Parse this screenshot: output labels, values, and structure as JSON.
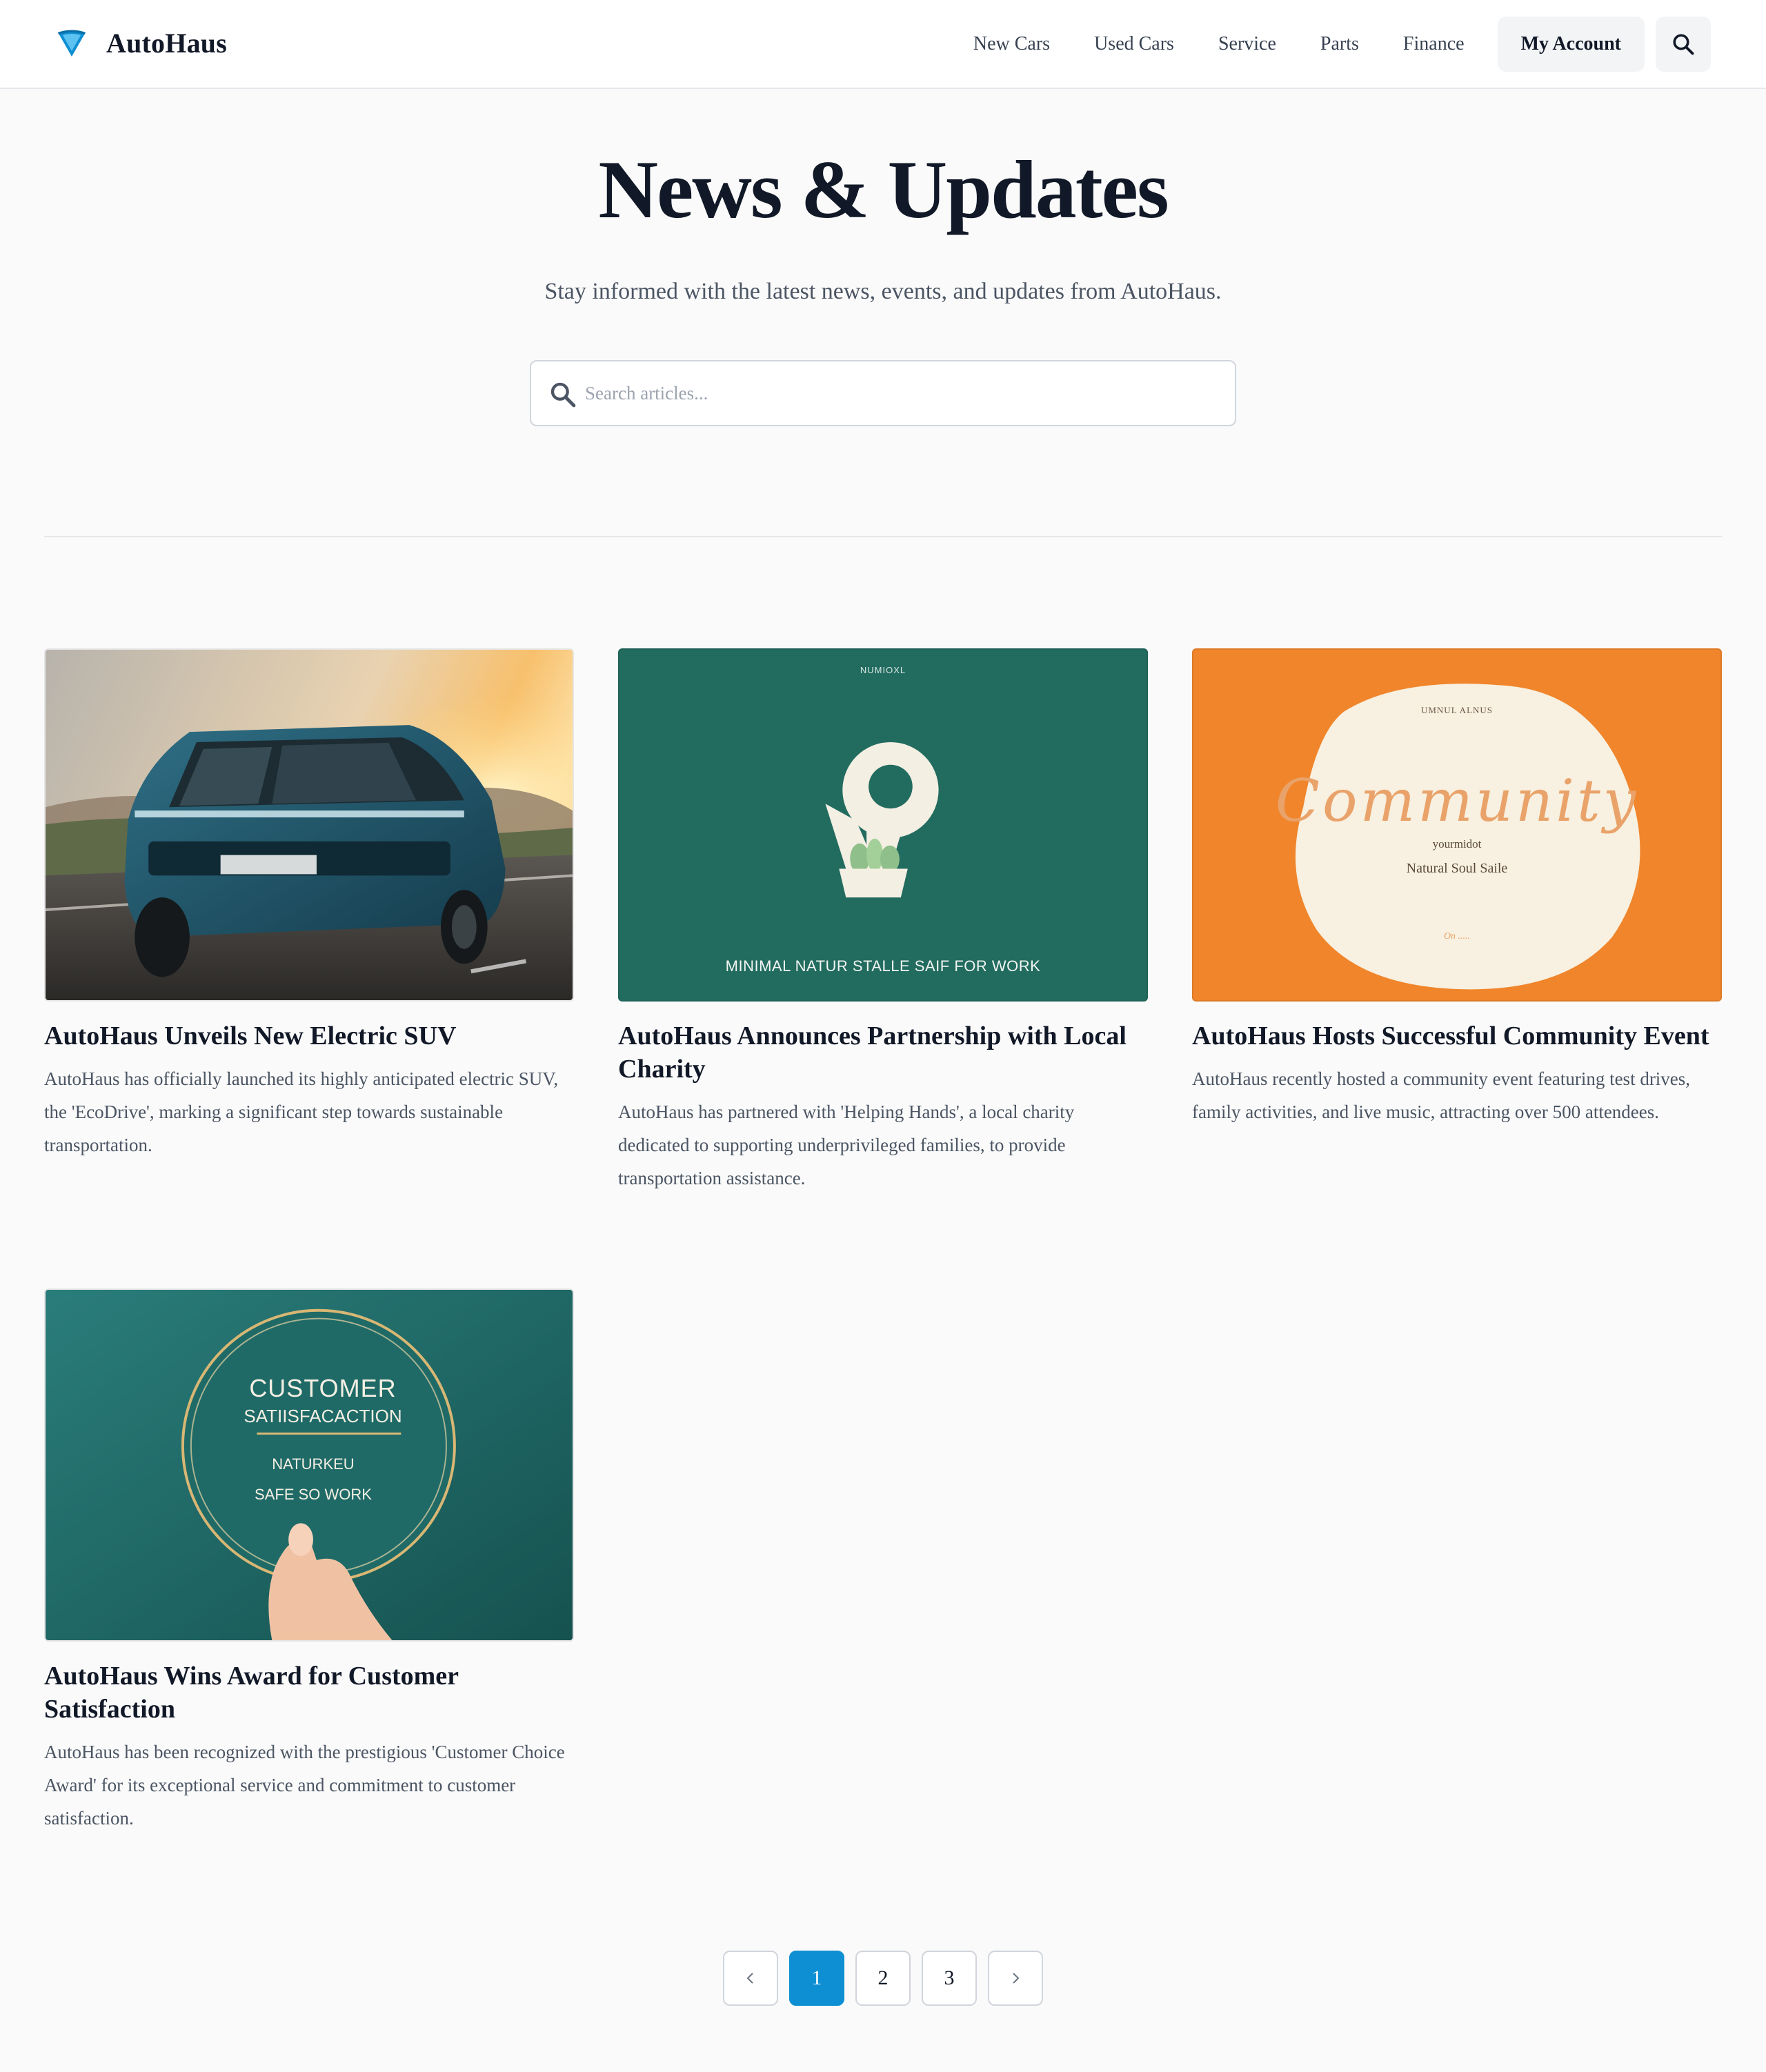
{
  "brand": {
    "name": "AutoHaus",
    "accent_color": "#0e8fd3"
  },
  "nav": {
    "links": [
      "New Cars",
      "Used Cars",
      "Service",
      "Parts",
      "Finance"
    ],
    "account_label": "My Account",
    "search_icon": "search-icon"
  },
  "hero": {
    "title": "News & Updates",
    "subtitle": "Stay informed with the latest news, events, and updates from AutoHaus.",
    "search_placeholder": "Search articles..."
  },
  "articles": [
    {
      "title": "AutoHaus Unveils New Electric SUV",
      "excerpt": "AutoHaus has officially launched its highly anticipated electric SUV, the 'EcoDrive', marking a significant step towards sustainable transportation.",
      "image": "electric-suv-on-road"
    },
    {
      "title": "AutoHaus Announces Partnership with Local Charity",
      "excerpt": "AutoHaus has partnered with 'Helping Hands', a local charity dedicated to supporting underprivileged families, to provide transportation assistance.",
      "image": "charity-plant-illustration",
      "image_text": {
        "top": "NUMIOXL",
        "bottom": "MINIMAL NATUR STALLE SAIF FOR WORK"
      }
    },
    {
      "title": "AutoHaus Hosts Successful Community Event",
      "excerpt": "AutoHaus recently hosted a community event featuring test drives, family activities, and live music, attracting over 500 attendees.",
      "image": "community-event-card",
      "image_text": {
        "top": "UMNUL ALNUS",
        "script": "Community",
        "line1": "yourmidot",
        "line2": "Natural Soul Saile",
        "line3": "On ....."
      }
    },
    {
      "title": "AutoHaus Wins Award for Customer Satisfaction",
      "excerpt": "AutoHaus has been recognized with the prestigious 'Customer Choice Award' for its exceptional service and commitment to customer satisfaction.",
      "image": "customer-satisfaction-badge",
      "image_text": {
        "line1": "CUSTOMER",
        "line2": "SATIISFACACTION",
        "line3": "NATURKEU",
        "line4": "SAFE SO WORK"
      }
    }
  ],
  "pagination": {
    "pages": [
      "1",
      "2",
      "3"
    ],
    "current": "1",
    "prev_icon": "chevron-left-icon",
    "next_icon": "chevron-right-icon"
  }
}
